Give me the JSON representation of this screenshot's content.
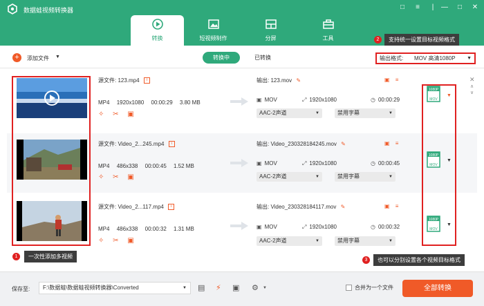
{
  "app": {
    "title": "数据蛙视频转换器"
  },
  "tabs": [
    {
      "label": "转换",
      "icon": "convert-icon",
      "active": true
    },
    {
      "label": "短视频制作",
      "icon": "short-video-icon",
      "active": false
    },
    {
      "label": "分屏",
      "icon": "split-screen-icon",
      "active": false
    },
    {
      "label": "工具",
      "icon": "toolbox-icon",
      "active": false
    }
  ],
  "toolbar": {
    "add_label": "添加文件",
    "seg_converting": "转换中",
    "seg_converted": "已转换",
    "format_label": "输出格式:",
    "format_value": "MOV 高清1080P"
  },
  "tips": {
    "tip1_num": "1",
    "tip1_text": "一次性添加多视频",
    "tip2_num": "2",
    "tip2_text": "支持统一设置目标视频格式",
    "tip3_num": "3",
    "tip3_text": "也可以分别设置各个视频目标格式"
  },
  "rows": [
    {
      "source": "源文件: 123.mp4",
      "format": "MP4",
      "resolution": "1920x1080",
      "duration": "00:00:29",
      "size": "3.80 MB",
      "output": "输出: 123.mov",
      "out_format": "MOV",
      "out_resolution": "1920x1080",
      "out_duration": "00:00:29",
      "audio": "AAC-2声道",
      "subtitle": "禁用字幕",
      "badge": "1080P",
      "badge_sub": "MOV"
    },
    {
      "source": "源文件: Video_2...245.mp4",
      "format": "MP4",
      "resolution": "486x338",
      "duration": "00:00:45",
      "size": "1.52 MB",
      "output": "输出: Video_230328184245.mov",
      "out_format": "MOV",
      "out_resolution": "1920x1080",
      "out_duration": "00:00:45",
      "audio": "AAC-2声道",
      "subtitle": "禁用字幕",
      "badge": "1080P",
      "badge_sub": "MOV"
    },
    {
      "source": "源文件: Video_2...117.mp4",
      "format": "MP4",
      "resolution": "486x338",
      "duration": "00:00:32",
      "size": "1.31 MB",
      "output": "输出: Video_230328184117.mov",
      "out_format": "MOV",
      "out_resolution": "1920x1080",
      "out_duration": "00:00:32",
      "audio": "AAC-2声道",
      "subtitle": "禁用字幕",
      "badge": "1080P",
      "badge_sub": "MOV"
    }
  ],
  "footer": {
    "save_label": "保存至:",
    "path": "F:\\数据蛙\\数据蛙视频转换器\\Converted",
    "merge_label": "合并为一个文件",
    "convert_all": "全部转换"
  },
  "colors": {
    "brand": "#2fa97b",
    "accent": "#f05a28",
    "highlight": "#e02020"
  }
}
